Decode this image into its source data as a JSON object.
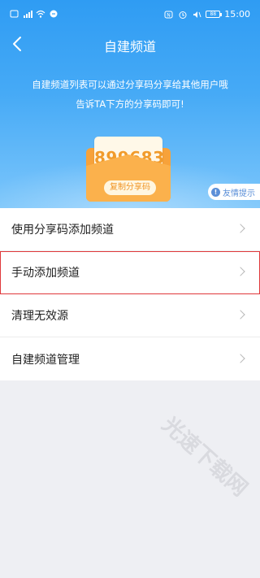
{
  "status_bar": {
    "time": "15:00",
    "battery": "88",
    "left_icons": [
      "sim-icon",
      "signal-icon",
      "wifi-icon",
      "app-icon"
    ],
    "right_icons": [
      "nfc-icon",
      "alarm-icon",
      "mute-icon",
      "battery-icon"
    ]
  },
  "header": {
    "title": "自建频道",
    "back_icon": "back-arrow-icon"
  },
  "hero": {
    "description_line1": "自建频道列表可以通过分享码分享给其他用户哦",
    "description_line2": "告诉TA下方的分享码即可!",
    "share_code": "899683",
    "copy_button_label": "复制分享码",
    "tip_label": "友情提示",
    "colors": {
      "gradient_top": "#2f9cf3",
      "gradient_bottom": "#7cc6fb",
      "envelope": "#f7a23a"
    }
  },
  "menu": {
    "items": [
      {
        "label": "使用分享码添加频道",
        "highlighted": false
      },
      {
        "label": "手动添加频道",
        "highlighted": true
      },
      {
        "label": "清理无效源",
        "highlighted": false
      },
      {
        "label": "自建频道管理",
        "highlighted": false
      }
    ],
    "highlight_color": "#e0383b"
  },
  "watermark": "光速下载网"
}
